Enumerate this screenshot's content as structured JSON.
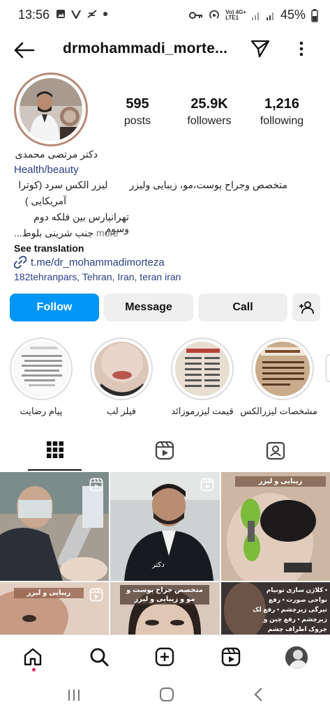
{
  "status_bar": {
    "time": "13:56",
    "signal_text": "Vo) 4G+\nLTE1",
    "battery": "45%"
  },
  "header": {
    "username": "drmohammadi_morte..."
  },
  "stats": {
    "posts_count": "595",
    "posts_label": "posts",
    "followers_count": "25.9K",
    "followers_label": "followers",
    "following_count": "1,216",
    "following_label": "following"
  },
  "bio": {
    "name": "دکتر مرتضی محمدی",
    "category": "Health/beauty",
    "line1": "متخصص وجراح پوست،مو، زیبایی ولیزر        لیزر الکس سرد (کوترا",
    "line2": "آمریکایی )",
    "line3": "تهرانپارس بین فلکه دوم وسوم",
    "line4": "جنب شرینی بلوط...",
    "more": "more",
    "see_translation": "See translation",
    "link": "t.me/dr_mohammadimorteza",
    "address": "182tehranpars, Tehran, Iran, teran iran"
  },
  "actions": {
    "follow": "Follow",
    "message": "Message",
    "call": "Call"
  },
  "highlights": [
    {
      "label": "پیام رضایت"
    },
    {
      "label": "فیلر لب"
    },
    {
      "label": "قیمت لیزرموزائد"
    },
    {
      "label": "مشخصات لیزرالکس"
    }
  ],
  "grid": {
    "tiles": [
      {
        "caption": ""
      },
      {
        "caption": "دکتر"
      },
      {
        "caption": "زیبایی و لیزر"
      },
      {
        "caption": "زیبایی و لیزر"
      },
      {
        "caption": "متخصص جراح پوست و مو و زیبایی و لیزر"
      },
      {
        "caption": "• کلاژن سازی تونیام نواحی صورت • رفع تیرگی زیرچشم • رفع لک زیرچشم • رفع چین و چروک اطراف چشم"
      }
    ]
  },
  "colors": {
    "follow_blue": "#0095f6",
    "link_blue": "#2a3f87",
    "button_gray": "#efefef"
  }
}
